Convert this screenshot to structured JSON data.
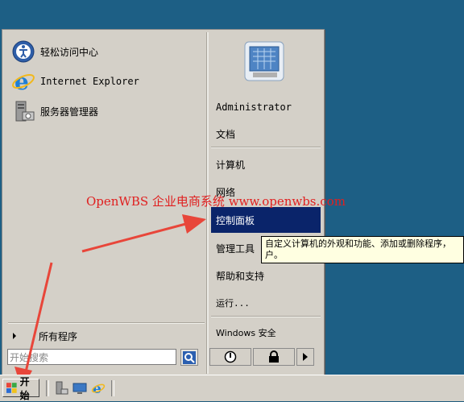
{
  "start_menu": {
    "pinned": [
      {
        "label": "轻松访问中心",
        "icon": "ease-of-access-icon"
      },
      {
        "label": "Internet Explorer",
        "icon": "internet-explorer-icon"
      },
      {
        "label": "服务器管理器",
        "icon": "server-manager-icon"
      }
    ],
    "all_programs": "所有程序",
    "search_placeholder": "开始搜索",
    "right": {
      "user": "Administrator",
      "documents": "文档",
      "computer": "计算机",
      "network": "网络",
      "control_panel": "控制面板",
      "admin_tools": "管理工具",
      "help": "帮助和支持",
      "run": "运行...",
      "security": "Windows 安全"
    },
    "tooltip": "自定义计算机的外观和功能、添加或删除程序，户。",
    "selected_color": "#0a246a"
  },
  "watermark": "OpenWBS 企业电商系统 www.openwbs.com",
  "taskbar": {
    "start_label": "开始",
    "quick_launch": [
      "server-manager-icon",
      "show-desktop-icon",
      "internet-explorer-icon"
    ]
  },
  "colors": {
    "desktop": "#1d5f85",
    "menu": "#d4d0c8",
    "annotation": "#e8463a"
  }
}
